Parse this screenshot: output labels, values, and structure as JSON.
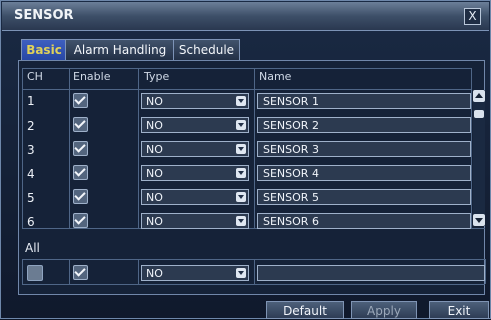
{
  "window": {
    "title": "SENSOR",
    "close_label": "X"
  },
  "tabs": [
    {
      "label": "Basic",
      "active": true
    },
    {
      "label": "Alarm Handling",
      "active": false
    },
    {
      "label": "Schedule",
      "active": false
    }
  ],
  "table": {
    "headers": [
      "CH",
      "Enable",
      "Type",
      "Name"
    ],
    "rows": [
      {
        "ch": "1",
        "enabled": true,
        "type": "NO",
        "name": "SENSOR 1"
      },
      {
        "ch": "2",
        "enabled": true,
        "type": "NO",
        "name": "SENSOR 2"
      },
      {
        "ch": "3",
        "enabled": true,
        "type": "NO",
        "name": "SENSOR 3"
      },
      {
        "ch": "4",
        "enabled": true,
        "type": "NO",
        "name": "SENSOR 4"
      },
      {
        "ch": "5",
        "enabled": true,
        "type": "NO",
        "name": "SENSOR 5"
      },
      {
        "ch": "6",
        "enabled": true,
        "type": "NO",
        "name": "SENSOR 6"
      }
    ]
  },
  "all_section": {
    "label": "All",
    "enabled": true,
    "type": "NO",
    "name": ""
  },
  "buttons": {
    "default": "Default",
    "apply": "Apply",
    "exit": "Exit"
  },
  "colors": {
    "background": "#0c1526",
    "active_tab_text": "#e0d15a",
    "window_border": "#6e87aa"
  }
}
